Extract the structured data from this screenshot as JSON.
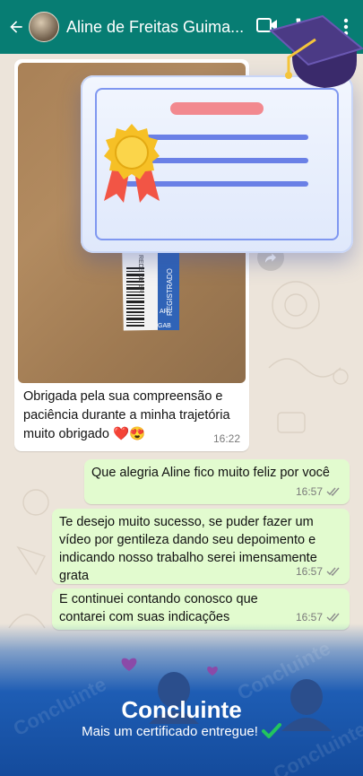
{
  "header": {
    "contact_name": "Aline de Freitas Guima...",
    "background": "#077d73"
  },
  "messages": [
    {
      "direction": "in",
      "has_photo": true,
      "text": "Obrigada pela sua compreensão e paciência durante a minha trajetória muito obrigado",
      "emoji": "❤️😍",
      "time": "16:22"
    },
    {
      "direction": "out",
      "text": "Que alegria Aline fico muito feliz por você",
      "time": "16:57"
    },
    {
      "direction": "out",
      "text": "Te desejo muito sucesso, se puder fazer um vídeo por gentileza dando seu depoimento e indicando nosso trabalho serei imensamente grata",
      "time": "16:57"
    },
    {
      "direction": "out",
      "text": "E continuei contando conosco que contarei com suas indicações",
      "time": "16:57"
    }
  ],
  "photo_labels": {
    "registered": "REGISTRADO",
    "code": "REDE DE BR",
    "ar": "AR",
    "gab": "GAB"
  },
  "banner": {
    "title": "Concluinte",
    "subtitle": "Mais um certificado entregue!",
    "watermark": "Concluinte",
    "check_color": "#22c55e"
  },
  "icons": [
    "back-arrow-icon",
    "video-call-icon",
    "phone-icon",
    "more-vert-icon",
    "forward-icon",
    "double-check-icon",
    "certificate-icon",
    "graduation-cap-icon",
    "seal-ribbon-icon",
    "heart-icon",
    "check-mark-icon"
  ]
}
